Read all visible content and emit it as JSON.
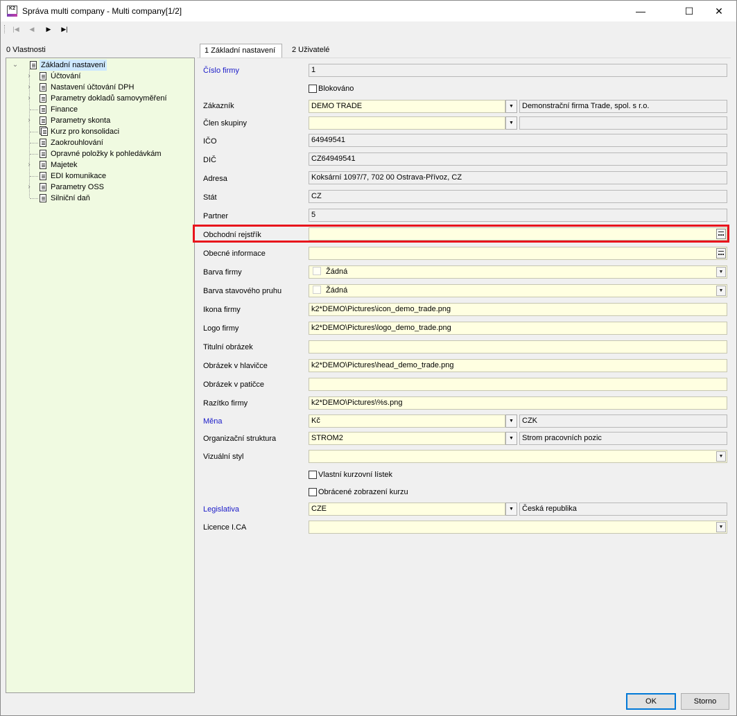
{
  "window": {
    "title": "Správa multi company - Multi company[1/2]",
    "app_icon_text": "K2",
    "minimize": "—",
    "maximize": "☐",
    "close": "✕"
  },
  "navigator": {
    "first": "|◀",
    "prev": "◀",
    "next": "▶",
    "last": "▶|"
  },
  "left_panel": {
    "label": "0 Vlastnosti",
    "tree": [
      {
        "label": "Základní nastavení",
        "expanded": true
      },
      {
        "label": "Účtování",
        "expandable": true
      },
      {
        "label": "Nastavení účtování DPH",
        "expandable": true
      },
      {
        "label": "Parametry dokladů samovyměření",
        "expandable": true
      },
      {
        "label": "Finance",
        "expandable": false
      },
      {
        "label": "Parametry skonta",
        "expandable": true
      },
      {
        "label": "Kurz pro konsolidaci",
        "expandable": false
      },
      {
        "label": "Zaokrouhlování",
        "expandable": false
      },
      {
        "label": "Opravné položky k pohledávkám",
        "expandable": false
      },
      {
        "label": "Majetek",
        "expandable": true
      },
      {
        "label": "EDI komunikace",
        "expandable": false
      },
      {
        "label": "Parametry OSS",
        "expandable": true
      },
      {
        "label": "Silniční daň",
        "expandable": false
      }
    ]
  },
  "tabs": [
    {
      "label": "1 Základní nastavení",
      "active": true
    },
    {
      "label": "2 Uživatelé",
      "active": false
    }
  ],
  "form": {
    "cislo_firmy": {
      "label": "Číslo firmy",
      "value": "1"
    },
    "blokovano": {
      "label": "Blokováno",
      "checked": false
    },
    "zakaznik": {
      "label": "Zákazník",
      "value": "DEMO TRADE",
      "desc": "Demonstrační firma Trade, spol. s r.o."
    },
    "clen_skupiny": {
      "label": "Člen skupiny",
      "value": "",
      "desc": ""
    },
    "ico": {
      "label": "IČO",
      "value": "64949541"
    },
    "dic": {
      "label": "DIČ",
      "value": "CZ64949541"
    },
    "adresa": {
      "label": "Adresa",
      "value": "Koksární 1097/7, 702 00  Ostrava-Přívoz, CZ"
    },
    "stat": {
      "label": "Stát",
      "value": "CZ"
    },
    "partner": {
      "label": "Partner",
      "value": "5"
    },
    "obchodni_rejstrik": {
      "label": "Obchodní rejstřík",
      "value": ""
    },
    "obecne_informace": {
      "label": "Obecné informace",
      "value": ""
    },
    "barva_firmy": {
      "label": "Barva firmy",
      "value": "Žádná"
    },
    "barva_pruhu": {
      "label": "Barva stavového pruhu",
      "value": "Žádná"
    },
    "ikona_firmy": {
      "label": "Ikona firmy",
      "value": "k2*DEMO\\Pictures\\icon_demo_trade.png"
    },
    "logo_firmy": {
      "label": "Logo firmy",
      "value": "k2*DEMO\\Pictures\\logo_demo_trade.png"
    },
    "titulni_obrazek": {
      "label": "Titulní obrázek",
      "value": ""
    },
    "obrazek_hlavicce": {
      "label": "Obrázek v hlavičce",
      "value": "k2*DEMO\\Pictures\\head_demo_trade.png"
    },
    "obrazek_paticce": {
      "label": "Obrázek v patičce",
      "value": ""
    },
    "razitko_firmy": {
      "label": "Razítko firmy",
      "value": "k2*DEMO\\Pictures\\%s.png"
    },
    "mena": {
      "label": "Měna",
      "value": "Kč",
      "desc": "CZK"
    },
    "org_struktura": {
      "label": "Organizační struktura",
      "value": "STROM2",
      "desc": "Strom pracovních pozic"
    },
    "vizualni_styl": {
      "label": "Vizuální styl",
      "value": ""
    },
    "vlastni_kurzovni": {
      "label": "Vlastní kurzovní lístek",
      "checked": false
    },
    "obracene_zobrazeni": {
      "label": "Obrácené zobrazení kurzu",
      "checked": false
    },
    "legislativa": {
      "label": "Legislativa",
      "value": "CZE",
      "desc": "Česká republika"
    },
    "licence_ica": {
      "label": "Licence I.CA",
      "value": ""
    }
  },
  "buttons": {
    "ok": "OK",
    "storno": "Storno"
  },
  "colors": {
    "tree_bg": "#f0fae1",
    "input_yellow": "#ffffe1",
    "required_label": "#1a1ac8",
    "highlight": "#e8141c",
    "default_button_border": "#0078d7"
  }
}
